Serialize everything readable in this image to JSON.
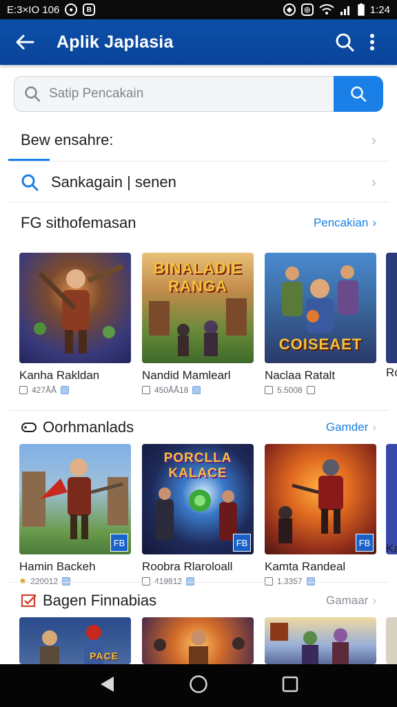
{
  "status_bar": {
    "time_left": "E:3×IO 106",
    "time_right": "1:24"
  },
  "app_bar": {
    "title": "Aplik Japlasia"
  },
  "search": {
    "placeholder": "Satip Pencakain"
  },
  "nav_rows": [
    {
      "label": "Bew ensahre:"
    },
    {
      "label": "Sankagain | senen"
    }
  ],
  "sections": [
    {
      "title": "FG sithofemasan",
      "link": "Pencakian",
      "games": [
        {
          "name": "Kanha Rakldan",
          "meta": "427ÅÅ",
          "thumb_text": ""
        },
        {
          "name": "Nandid Mamlearl",
          "meta": "450ÅÅ18",
          "thumb_text": "BINALADIE RANGA"
        },
        {
          "name": "Naclaa Ratalt",
          "meta": "5.5008",
          "thumb_text": "COISEAET"
        }
      ],
      "peek_name": "Ro"
    },
    {
      "title": "Oorhmanlads",
      "link": "Gamder",
      "games": [
        {
          "name": "Hamin Backeh",
          "meta": "220012",
          "badge": "FB"
        },
        {
          "name": "Roobra Rlaroloall",
          "meta": "419812",
          "badge": "FB",
          "thumb_text": "PORCLLA KALACE"
        },
        {
          "name": "Kamta Randeal",
          "meta": "1.3357",
          "badge": "FB"
        }
      ],
      "peek_name": "Ka"
    },
    {
      "title": "Bagen Finnabias",
      "link": "Gamaar",
      "games": [
        {
          "name": "",
          "thumb_text": "PACE"
        },
        {
          "name": ""
        },
        {
          "name": ""
        }
      ]
    }
  ],
  "colors": {
    "primary": "#0c4fa8",
    "accent": "#1a7fe6"
  }
}
